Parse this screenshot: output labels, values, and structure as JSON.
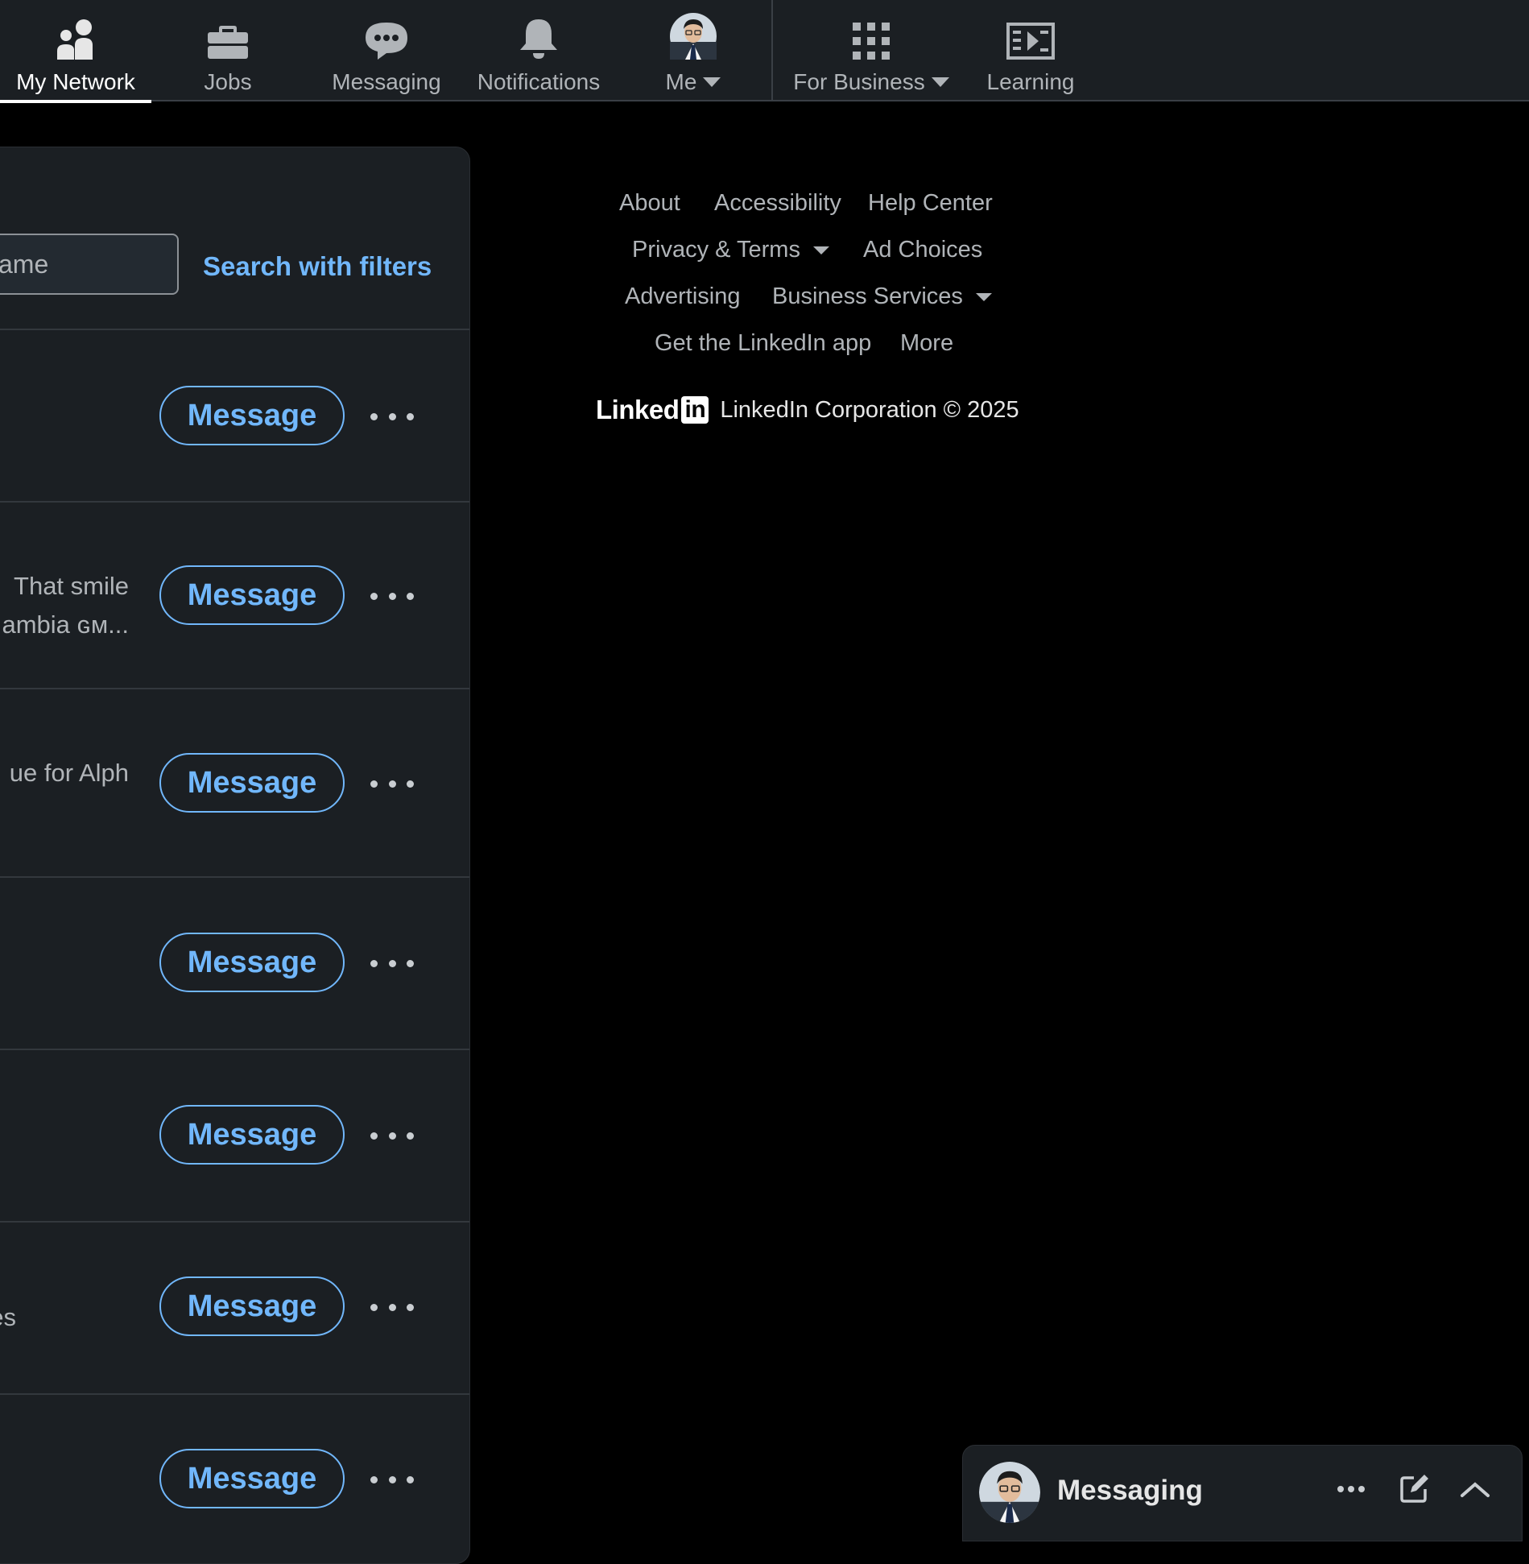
{
  "nav": {
    "items": [
      {
        "key": "my-network",
        "label": "My Network",
        "active": true
      },
      {
        "key": "jobs",
        "label": "Jobs"
      },
      {
        "key": "messaging",
        "label": "Messaging"
      },
      {
        "key": "notifications",
        "label": "Notifications"
      },
      {
        "key": "me",
        "label": "Me"
      },
      {
        "key": "for-business",
        "label": "For Business"
      },
      {
        "key": "learning",
        "label": "Learning"
      }
    ]
  },
  "connections": {
    "search_placeholder": "ame",
    "search_filters": "Search with filters",
    "message_label": "Message",
    "rows": [
      {
        "text": ""
      },
      {
        "text_line1": "That smile",
        "text_line2": "ambia ɢᴍ..."
      },
      {
        "text_line1": "ue for Alph"
      },
      {
        "text": ""
      },
      {
        "text": ""
      },
      {
        "text_line1": "es"
      },
      {
        "text": ""
      }
    ]
  },
  "footer": {
    "links": {
      "about": "About",
      "accessibility": "Accessibility",
      "help_center": "Help Center",
      "privacy_terms": "Privacy & Terms",
      "ad_choices": "Ad Choices",
      "advertising": "Advertising",
      "business_services": "Business Services",
      "get_app": "Get the LinkedIn app",
      "more": "More"
    },
    "brand_word": "Linked",
    "brand_in": "in",
    "copyright": "LinkedIn Corporation © 2025"
  },
  "messaging_bar": {
    "title": "Messaging"
  },
  "colors": {
    "accent": "#71b7fb",
    "surface": "#1b1f23",
    "background": "#000000"
  }
}
